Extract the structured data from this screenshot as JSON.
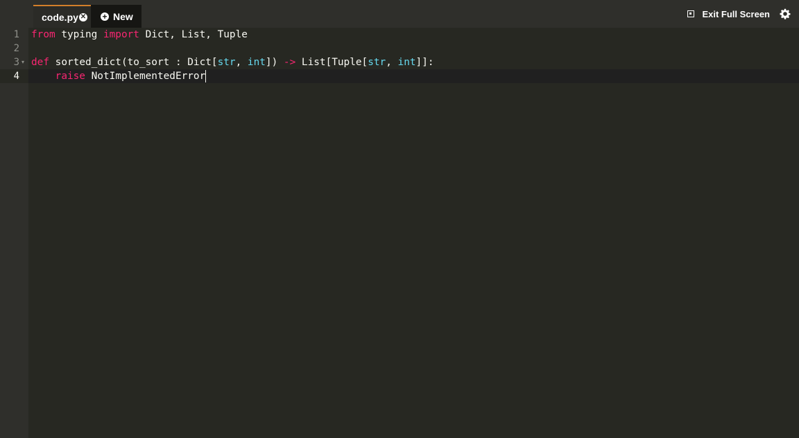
{
  "tabs": {
    "code_label": "code.py",
    "close_glyph": "✕",
    "new_label": "New",
    "plus_glyph": "+"
  },
  "toolbar": {
    "exit_fullscreen_label": "Exit Full Screen"
  },
  "editor": {
    "line_numbers": [
      "1",
      "2",
      "3",
      "4"
    ],
    "fold_glyph": "▾",
    "lines": {
      "l1": {
        "t1": "from",
        "t2": " typing ",
        "t3": "import",
        "t4": " Dict, List, Tuple"
      },
      "l3": {
        "t1": "def",
        "t2": " sorted_dict(to_sort : Dict[",
        "t3": "str",
        "t4": ", ",
        "t5": "int",
        "t6": "]) ",
        "t7": "->",
        "t8": " List[Tuple[",
        "t9": "str",
        "t10": ", ",
        "t11": "int",
        "t12": "]]:"
      },
      "l4": {
        "t0": "    ",
        "t1": "raise",
        "t2": " NotImplementedError"
      }
    }
  },
  "colors": {
    "keyword": "#f92672",
    "builtin": "#66d9ef",
    "text": "#f8f8f2",
    "tab_accent": "#d37f2a",
    "background": "#272822"
  },
  "icons": {
    "close": "close-circle-icon",
    "plus": "plus-circle-icon",
    "exit_fullscreen": "exit-fullscreen-icon",
    "settings": "gear-icon"
  }
}
